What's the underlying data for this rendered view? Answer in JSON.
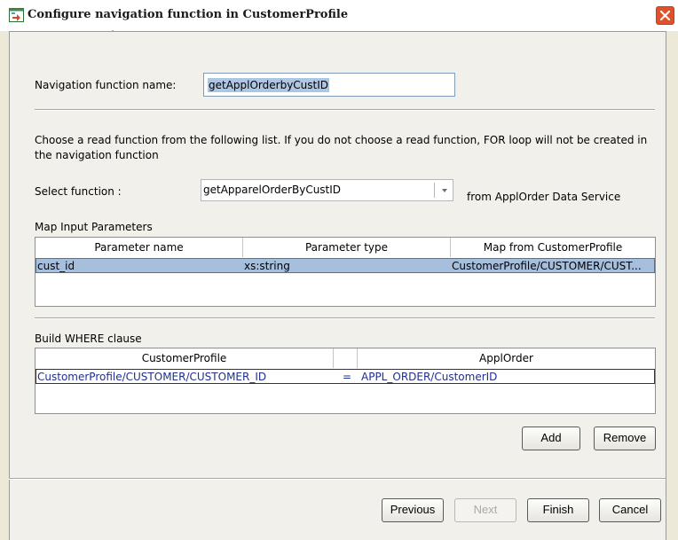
{
  "window": {
    "title": "Configure navigation function in CustomerProfile"
  },
  "nav_name": {
    "label": "Navigation function name:",
    "value": "getApplOrderbyCustID"
  },
  "description": "Choose a read function from the following list. If you do not choose a read function, FOR loop will not be created in the navigation function",
  "select_function": {
    "label": "Select function :",
    "value": "getApparelOrderByCustID",
    "suffix": "from ApplOrder Data Service"
  },
  "map_input": {
    "section_label": "Map Input Parameters",
    "columns": [
      "Parameter name",
      "Parameter type",
      "Map from CustomerProfile"
    ],
    "rows": [
      {
        "name": "cust_id",
        "type": "xs:string",
        "map": "CustomerProfile/CUSTOMER/CUST..."
      }
    ]
  },
  "where_clause": {
    "section_label": "Build WHERE clause",
    "columns": [
      "CustomerProfile",
      "",
      "ApplOrder"
    ],
    "rows": [
      {
        "left": "CustomerProfile/CUSTOMER/CUSTOMER_ID",
        "op": "=",
        "right": "APPL_ORDER/CustomerID"
      }
    ]
  },
  "buttons": {
    "add": "Add",
    "remove": "Remove",
    "previous": "Previous",
    "next": "Next",
    "finish": "Finish",
    "cancel": "Cancel"
  },
  "colors": {
    "selection": "#a6bfdc",
    "close": "#e0502b",
    "dialog_bg": "#f1f0ea"
  }
}
